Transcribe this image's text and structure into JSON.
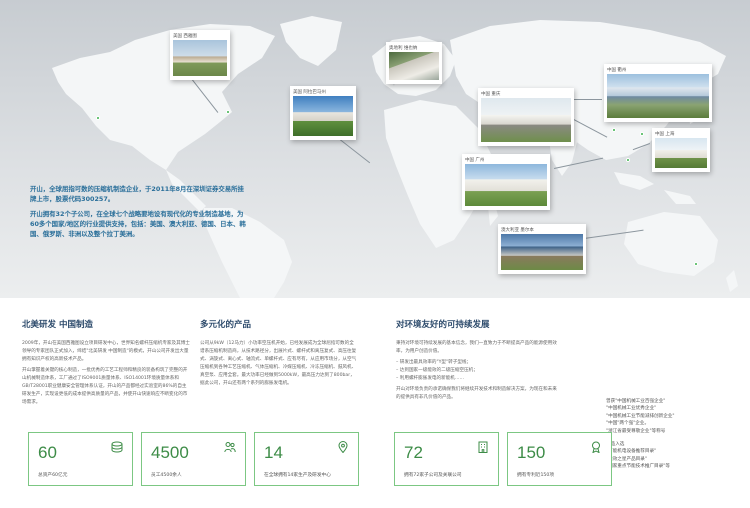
{
  "map": {
    "intro_p1": "开山，全球屈指可数的压缩机制造企业，于2011年8月在深圳证券交易所挂牌上市，股票代码300257。",
    "intro_p2": "开山拥有32个子公司，在全球七个战略要地设有现代化的专业制造基地，为60多个国家/地区的行业提供支持，包括：美国、澳大利亚、德国、日本、韩国、俄罗斯、非洲以及整个拉丁美洲。",
    "photos": [
      {
        "caption": "美国 西雅图"
      },
      {
        "caption": "美国 阿拉巴马州"
      },
      {
        "caption": "奥地利 维也纳"
      },
      {
        "caption": "中国 衢州"
      },
      {
        "caption": "中国 重庆"
      },
      {
        "caption": "中国 上海"
      },
      {
        "caption": "中国 广州"
      },
      {
        "caption": "澳大利亚 墨尔本"
      }
    ]
  },
  "columns": [
    {
      "title": "北美研发 中国制造",
      "paragraphs": [
        "2009年，开山在美国西雅图设立项目研发中心，世界知名螺杆压缩机专家及其博士领导的专家团队正式加入，缔结\"北美研发 中国制造\"的模式，开山公司开发出大量拥有知识产权的高新技术产品。",
        "开山掌握着关键的核心制造，一批优秀的工艺工程师和精良的装备构筑了完整的开山机械制造体系，工厂通过了ISO9001质量体系、ISO14001环境质量体系和GB/T28001职业健康安全管理体系认证，开山的产品都经过实验室的86%的自主研发生产，实现设更低的成本提供高质量的产品，并使开山快速响应不断变化的市场需求。"
      ]
    },
    {
      "title": "多元化的产品",
      "paragraphs": [
        "公司从9kW（12马力）小功率空压机开始，已经发展成为全球屈指可数的全谱系压缩机制造商，从技术路径分，出展片式、螺杆式和离压复式、高压往复式、涡旋式、离心式、轴流式、单螺杆式、应有尽有，从应用市场分，从空气压缩机到各种工艺压缩机、气体压缩机、冷媒压缩机、冷冻压缩机、鼓风机、真空泵、应用全套。最大功率已经做到5000kW，最高压力达到了800bar，据此公司，开山还有两个系列的膨胀发电机。"
      ]
    },
    {
      "title": "对环境友好的可持续发展",
      "paragraphs": [
        "秉持对环境可持续发展的基本信念，我们一直致力于不断提高产品的能源使用效率，为用户创造价值。",
        "– 研发出最具效率的\"Y型\"转子型线；",
        "– 达到国家一级能效的二级压缩空压机；",
        "– 利用螺杆膨胀发电的新能机……",
        "开山对环境负责的承诺确保我们将继续开发技术和制造解决方案，为现在和未来的提供具有非凡价值的产品。"
      ]
    }
  ],
  "honors": [
    "曾获\"中国机械工业百强企业\"",
    "\"中国机械工业优秀企业\"",
    "\"中国机械工业节能减排创新企业\"",
    "\"中国\"两个强\"企业。",
    "\"浙江省最受尊敬企业\"等称号",
    "",
    "产品入选",
    "\"节能机电设备推荐目录\"",
    "\"能效之星产品目录\"",
    "\"国家重点节能技术推广目录\"等"
  ],
  "stats": [
    {
      "value": "60",
      "label": "总资产60亿元",
      "icon": "coins-icon"
    },
    {
      "value": "4500",
      "label": "员工4500余人",
      "icon": "people-icon"
    },
    {
      "value": "14",
      "label": "在全球拥有14家生产及研发中心",
      "icon": "location-pin-icon"
    },
    {
      "value": "72",
      "label": "拥有72家子公司及关联公司",
      "icon": "building-icon"
    },
    {
      "value": "150",
      "label": "拥有专利近150项",
      "icon": "award-icon"
    }
  ],
  "colors": {
    "accent": "#3d8c47",
    "title": "#2c4a6b",
    "intro": "#2a6f9a",
    "card_border": "#7cc783"
  }
}
